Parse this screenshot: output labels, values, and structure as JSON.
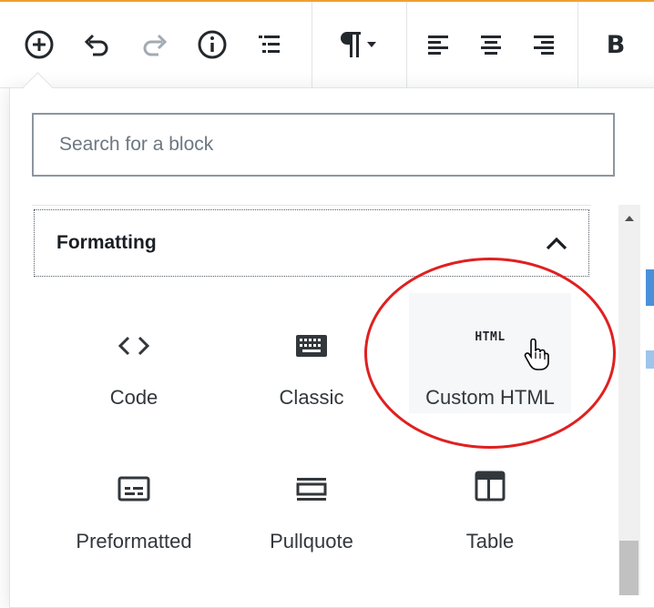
{
  "toolbar": {
    "buttons": [
      {
        "name": "add-block",
        "icon": "plus-circle-icon"
      },
      {
        "name": "undo",
        "icon": "undo-icon"
      },
      {
        "name": "redo",
        "icon": "redo-icon"
      },
      {
        "name": "info",
        "icon": "info-icon"
      },
      {
        "name": "outline",
        "icon": "list-icon"
      },
      {
        "name": "block-type",
        "icon": "pilcrow-icon"
      },
      {
        "name": "align-left",
        "icon": "align-left-icon"
      },
      {
        "name": "align-center",
        "icon": "align-center-icon"
      },
      {
        "name": "align-right",
        "icon": "align-right-icon"
      }
    ],
    "bold_label": "B"
  },
  "inserter": {
    "search_placeholder": "Search for a block",
    "panel": {
      "title": "Formatting",
      "expanded": true,
      "blocks": [
        {
          "label": "Code",
          "icon": "code-icon"
        },
        {
          "label": "Classic",
          "icon": "keyboard-icon"
        },
        {
          "label": "Custom HTML",
          "icon_text": "HTML",
          "hovered": true
        },
        {
          "label": "Preformatted",
          "icon": "preformatted-icon"
        },
        {
          "label": "Pullquote",
          "icon": "pullquote-icon"
        },
        {
          "label": "Table",
          "icon": "table-icon"
        }
      ]
    }
  },
  "colors": {
    "highlight_circle": "#e02020",
    "accent_top": "#f0a030",
    "text": "#23282d"
  }
}
